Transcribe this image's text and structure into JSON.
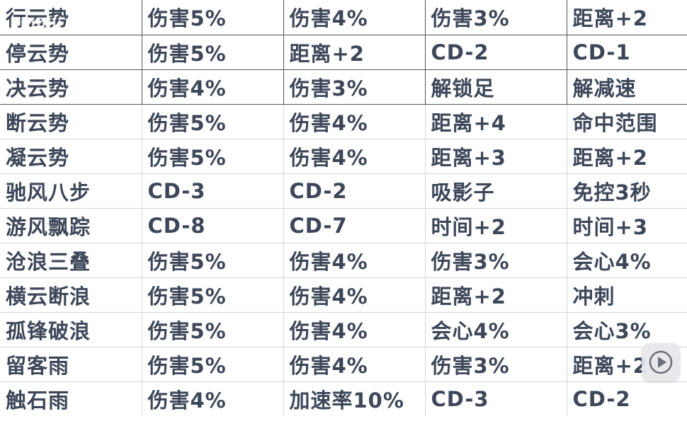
{
  "watermark": "bilibili",
  "rows": [
    [
      "行云势",
      "伤害5%",
      "伤害4%",
      "伤害3%",
      "距离+2"
    ],
    [
      "停云势",
      "伤害5%",
      "距离+2",
      "CD-2",
      "CD-1"
    ],
    [
      "决云势",
      "伤害4%",
      "伤害3%",
      "解锁足",
      "解减速"
    ],
    [
      "断云势",
      "伤害5%",
      "伤害4%",
      "距离+4",
      "命中范围"
    ],
    [
      "凝云势",
      "伤害5%",
      "伤害4%",
      "距离+3",
      "距离+2"
    ],
    [
      "驰风八步",
      "CD-3",
      "CD-2",
      "吸影子",
      "免控3秒"
    ],
    [
      "游风飘踪",
      "CD-8",
      "CD-7",
      "时间+2",
      "时间+3"
    ],
    [
      "沧浪三叠",
      "伤害5%",
      "伤害4%",
      "伤害3%",
      "会心4%"
    ],
    [
      "横云断浪",
      "伤害5%",
      "伤害4%",
      "距离+2",
      "冲刺"
    ],
    [
      "孤锋破浪",
      "伤害5%",
      "伤害4%",
      "会心4%",
      "会心3%"
    ],
    [
      "留客雨",
      "伤害5%",
      "伤害4%",
      "伤害3%",
      "距离+2"
    ],
    [
      "触石雨",
      "伤害4%",
      "加速率10%",
      "CD-3",
      "CD-2"
    ]
  ],
  "colors": {
    "text": "#3d4759",
    "grid_light": "#d7d7d7",
    "grid_dark": "#555555",
    "background": "#ffffff"
  },
  "icons": [
    "play-icon"
  ]
}
